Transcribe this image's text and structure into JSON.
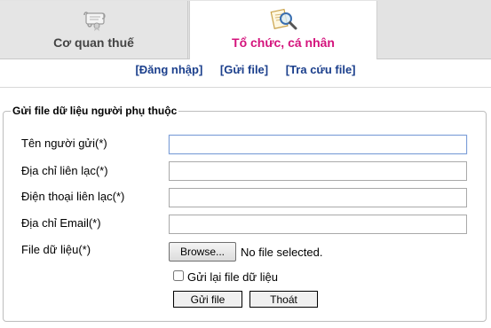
{
  "tabs": {
    "tax_office": {
      "label": "Cơ quan thuế",
      "icon": "scroll-icon"
    },
    "organization": {
      "label": "Tổ chức, cá nhân",
      "icon": "magnifier-document-icon"
    }
  },
  "subnav": {
    "login": "[Đăng nhập]",
    "send_file": "[Gửi file]",
    "lookup_file": "[Tra cứu file]"
  },
  "form": {
    "legend": "Gửi file dữ liệu người phụ thuộc",
    "sender_name_label": "Tên người gửi(*)",
    "sender_name_value": "",
    "address_label": "Địa chỉ liên lạc(*)",
    "address_value": "",
    "phone_label": "Điện thoại liên lạc(*)",
    "phone_value": "",
    "email_label": "Địa chỉ Email(*)",
    "email_value": "",
    "file_label": "File dữ liệu(*)",
    "browse_label": "Browse...",
    "no_file_text": "No file selected.",
    "resend_label": "Gửi lại file dữ liệu",
    "resend_checked": false,
    "submit_label": "Gửi file",
    "exit_label": "Thoát"
  },
  "colors": {
    "active_tab_text": "#d4137c",
    "link_blue": "#1b3f8c",
    "tab_background": "#e3e3e3"
  }
}
